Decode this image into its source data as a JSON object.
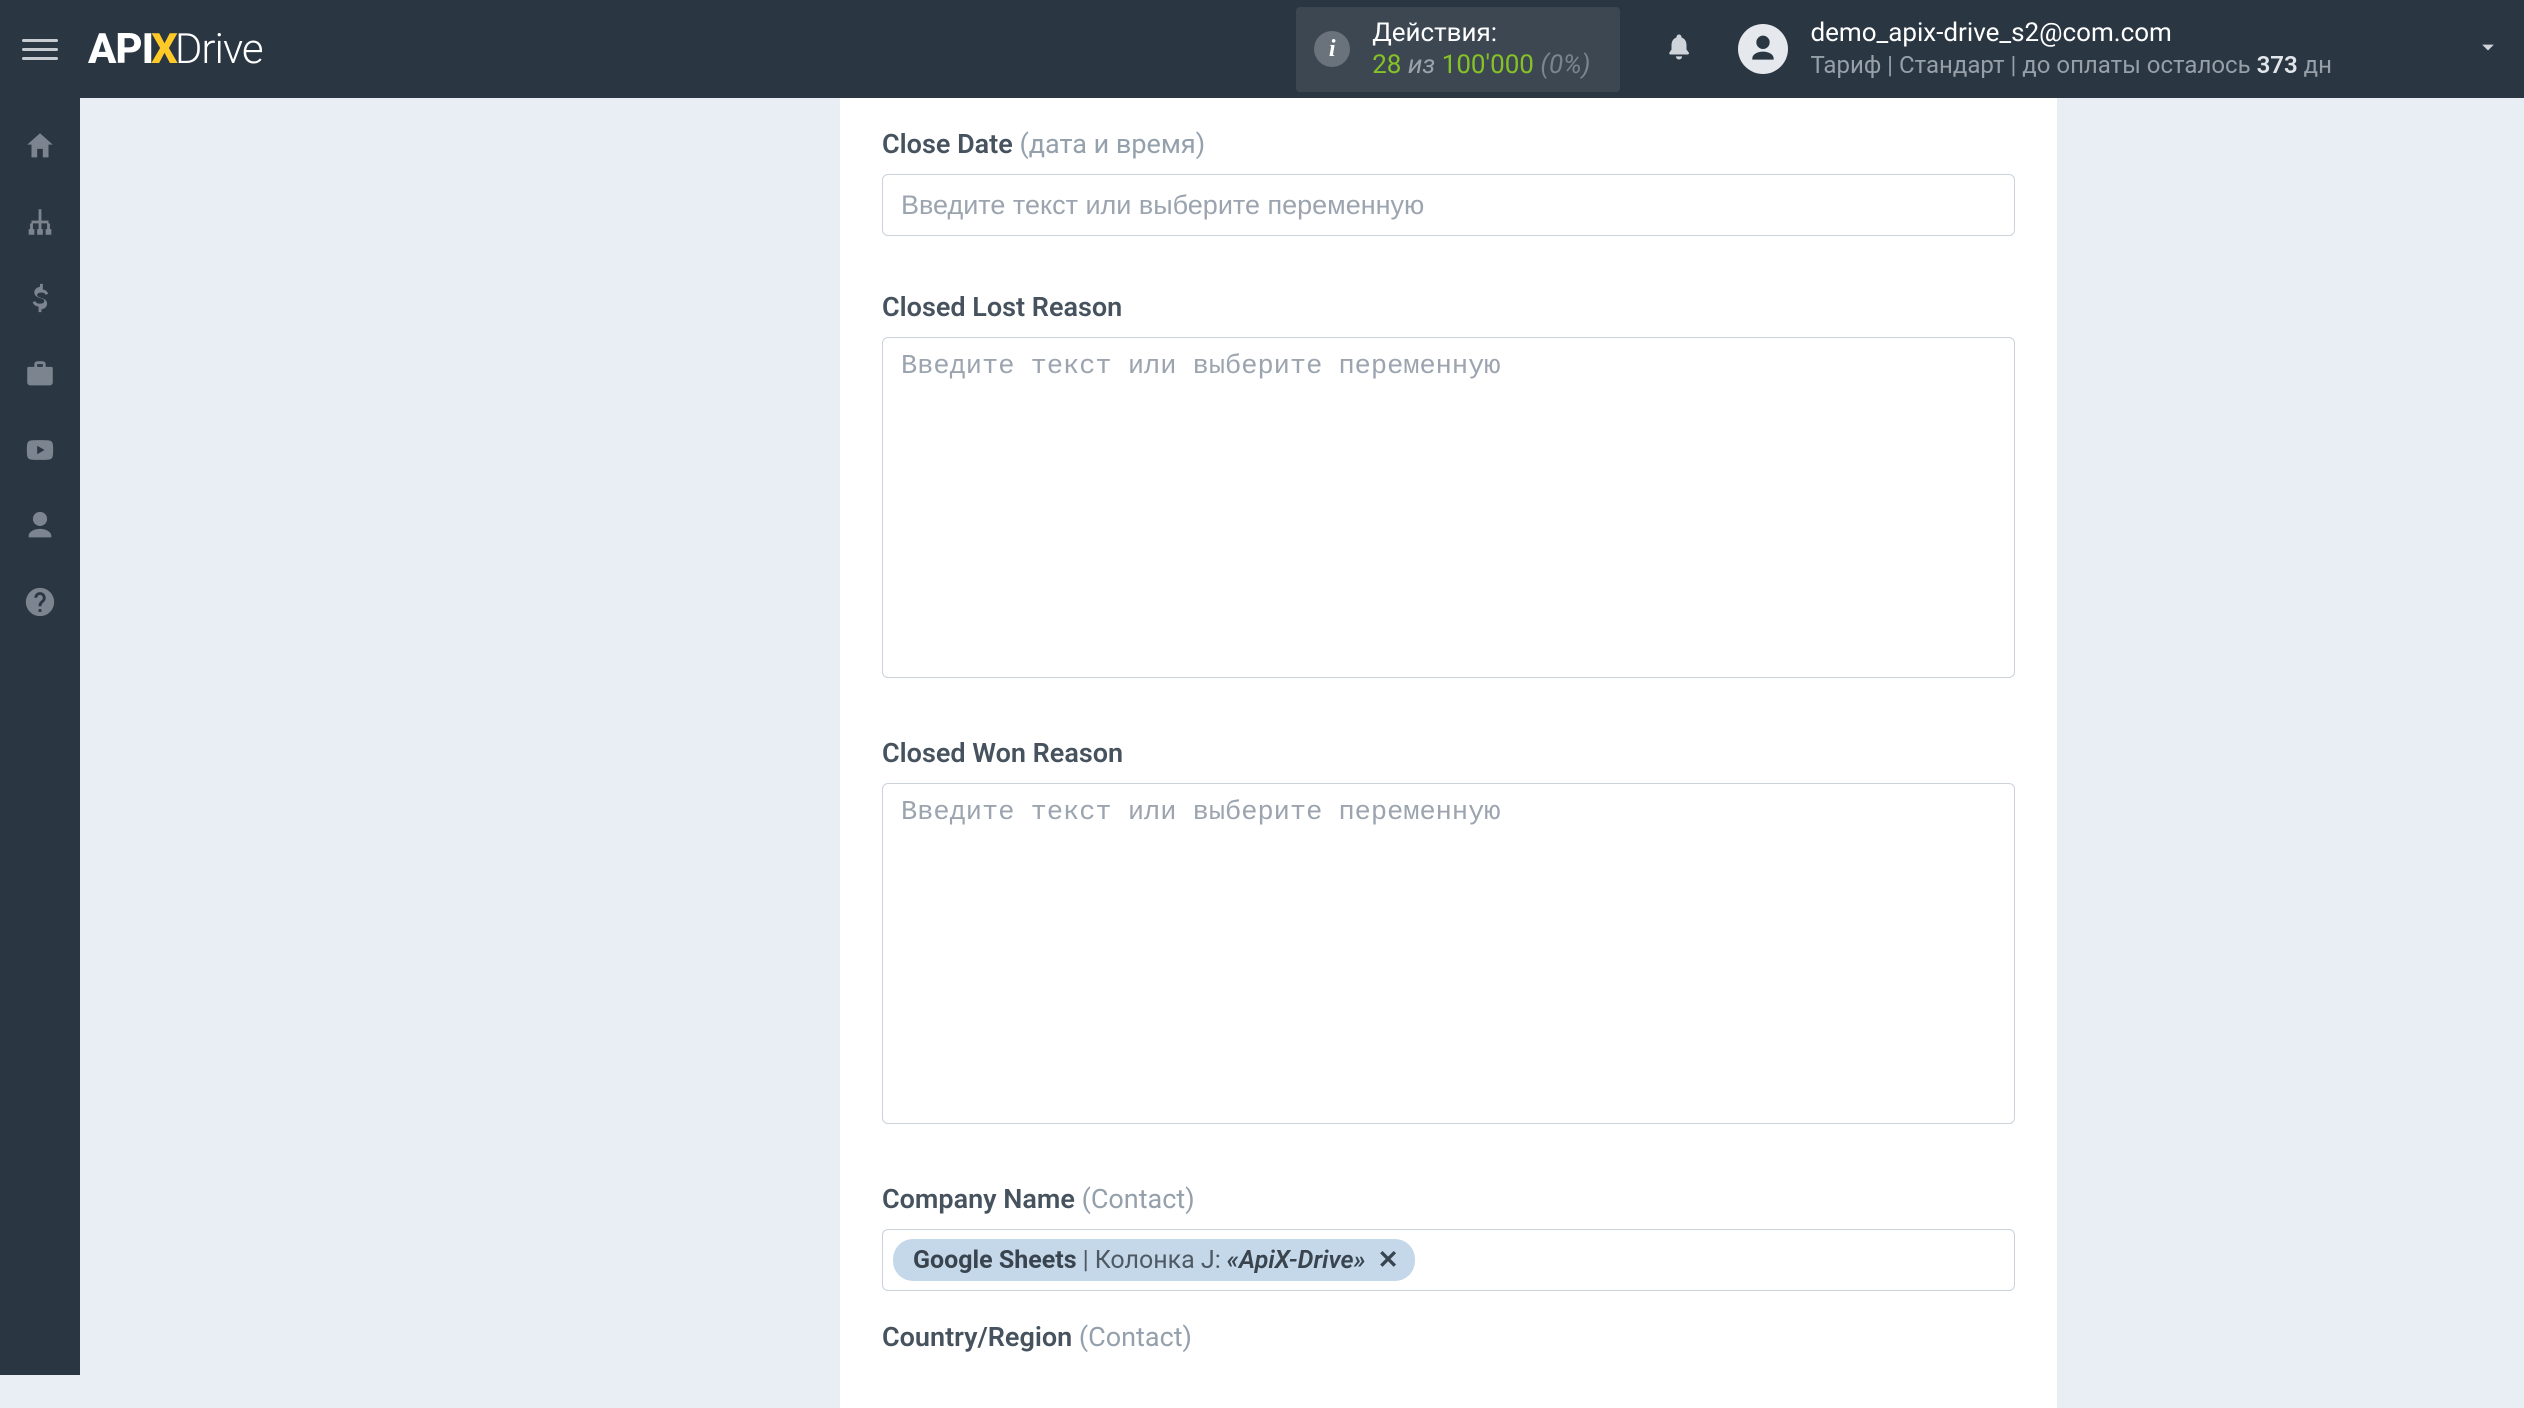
{
  "header": {
    "logo_api": "API",
    "logo_x": "X",
    "logo_drive": "Drive",
    "actions_label": "Действия:",
    "actions_count": "28",
    "actions_iz": "из",
    "actions_max": "100'000",
    "actions_pct": "(0%)",
    "user_email": "demo_apix-drive_s2@com.com",
    "tariff_prefix": "Тариф |",
    "tariff_name": "Стандарт",
    "tariff_mid": "| до оплаты осталось",
    "tariff_days": "373",
    "tariff_dn": "дн"
  },
  "fields": {
    "close_date": {
      "label": "Close Date",
      "hint": "(дата и время)",
      "placeholder": "Введите текст или выберите переменную"
    },
    "closed_lost": {
      "label": "Closed Lost Reason",
      "placeholder": "Введите текст или выберите переменную"
    },
    "closed_won": {
      "label": "Closed Won Reason",
      "placeholder": "Введите текст или выберите переменную"
    },
    "company_name": {
      "label": "Company Name",
      "hint": "(Contact)",
      "token_src": "Google Sheets",
      "token_pipe": "|",
      "token_col": "Колонка J:",
      "token_val": "«ApiX-Drive»",
      "token_close": "✕"
    },
    "country": {
      "label": "Country/Region",
      "hint": "(Contact)"
    }
  }
}
